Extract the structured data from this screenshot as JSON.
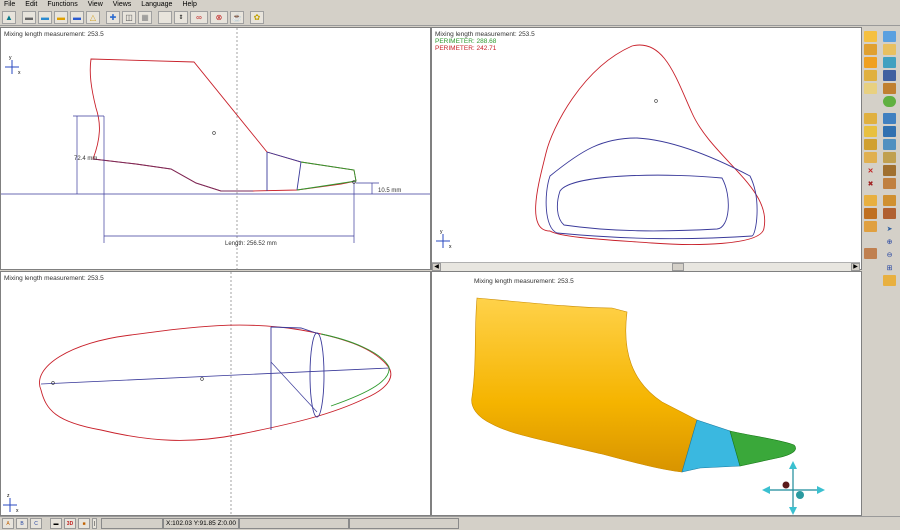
{
  "menu": [
    "File",
    "Edit",
    "Functions",
    "View",
    "Views",
    "Language",
    "Help"
  ],
  "toolbar_icons": [
    "foot-icon",
    "shoe-side-icon",
    "shoe-top-icon",
    "shoe-yellow-icon",
    "shoe-blue-icon",
    "plane-icon",
    "compass-icon",
    "split-icon",
    "grid-icon",
    "blank-icon",
    "stepper-icon",
    "chain-icon",
    "chain-cross-icon",
    "cup-icon",
    "bug-icon"
  ],
  "panels": {
    "side": {
      "title": "Mixing length measurement: 253.5",
      "height_label": "72.4 mm",
      "toe_label": "10.5 mm",
      "length_label": "Length: 256.52 mm",
      "axis_x": "x",
      "axis_y": "y"
    },
    "section": {
      "title": "Mixing length measurement: 253.5",
      "perimeter_green": "PERIMETER: 288.68",
      "perimeter_red": "PERIMETER: 242.71",
      "axis_x": "x",
      "axis_y": "y"
    },
    "top": {
      "title": "Mixing length measurement: 253.5",
      "axis_x": "x",
      "axis_y": "z"
    },
    "render3d": {
      "title": "Mixing length measurement: 253.5"
    }
  },
  "status": {
    "coords": "X:102.03 Y:91.85 Z:0.00"
  },
  "colors": {
    "red_outline": "#c8202a",
    "blue_line": "#3a3a9a",
    "green_line": "#2e9a2e",
    "last_yellow": "#f5b400",
    "last_cyan": "#3ab8e0",
    "last_green": "#3aa83a"
  }
}
